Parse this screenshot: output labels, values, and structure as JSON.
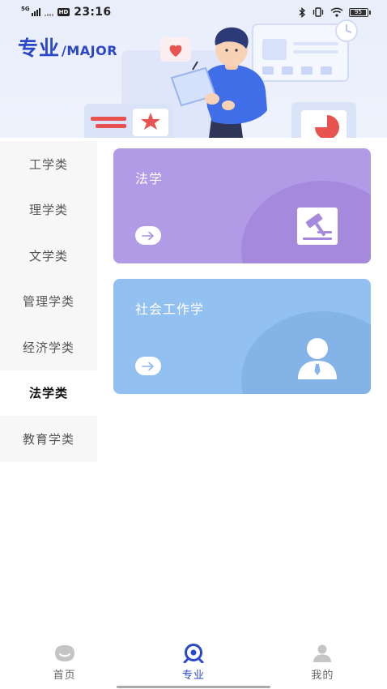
{
  "status_bar": {
    "network": "5G",
    "hd_badge": "HD",
    "time": "23:16",
    "battery": "95"
  },
  "banner": {
    "title_cn": "专业",
    "title_en": "/MAJOR"
  },
  "categories": [
    {
      "label": "工学类",
      "active": false
    },
    {
      "label": "理学类",
      "active": false
    },
    {
      "label": "文学类",
      "active": false
    },
    {
      "label": "管理学类",
      "active": false
    },
    {
      "label": "经济学类",
      "active": false
    },
    {
      "label": "法学类",
      "active": true
    },
    {
      "label": "教育学类",
      "active": false
    }
  ],
  "majors": [
    {
      "title": "法学",
      "color": "#b19ae6",
      "icon": "gavel-icon"
    },
    {
      "title": "社会工作学",
      "color": "#92c0f1",
      "icon": "person-icon"
    }
  ],
  "tabbar": {
    "tabs": [
      {
        "label": "首页",
        "icon": "home-icon",
        "active": false
      },
      {
        "label": "专业",
        "icon": "major-icon",
        "active": true
      },
      {
        "label": "我的",
        "icon": "profile-icon",
        "active": false
      }
    ]
  },
  "colors": {
    "accent": "#2b47c9",
    "sidebar_bg": "#f7f7f8"
  }
}
